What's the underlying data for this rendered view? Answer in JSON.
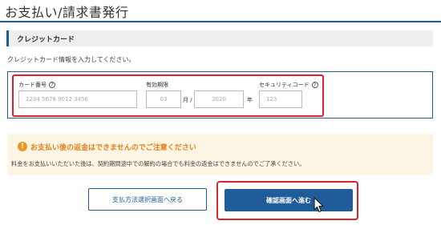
{
  "page": {
    "title": "お支払い/請求書発行"
  },
  "credit_section": {
    "header": "クレジットカード",
    "intro": "クレジットカード情報を入力してください。"
  },
  "card_form": {
    "number_label": "カード番号",
    "number_placeholder": "1234 5678 9012 3456",
    "expiry_label": "有効期限",
    "month_placeholder": "03",
    "month_unit": "月 /",
    "year_placeholder": "2020",
    "year_unit": "年",
    "security_label": "セキュリティコード",
    "security_placeholder": "123",
    "help_glyph": "?"
  },
  "warning": {
    "icon": "!",
    "title": "お支払い後の返金はできませんのでご注意ください",
    "text": "料金をお支払いいただいた後は、契約期間途中での解約の場合でも料金の返金はできませんのでご了承ください。"
  },
  "buttons": {
    "back_label": "支払方法選択画面へ戻る",
    "confirm_label": "確認画面へ進む"
  },
  "colors": {
    "accent": "#1f5c99",
    "highlight": "#d9232d",
    "warning": "#f1951e",
    "warning_bg": "#fdf6e4"
  },
  "icons": [
    "help-icon",
    "warning-icon",
    "mouse-cursor-icon"
  ]
}
